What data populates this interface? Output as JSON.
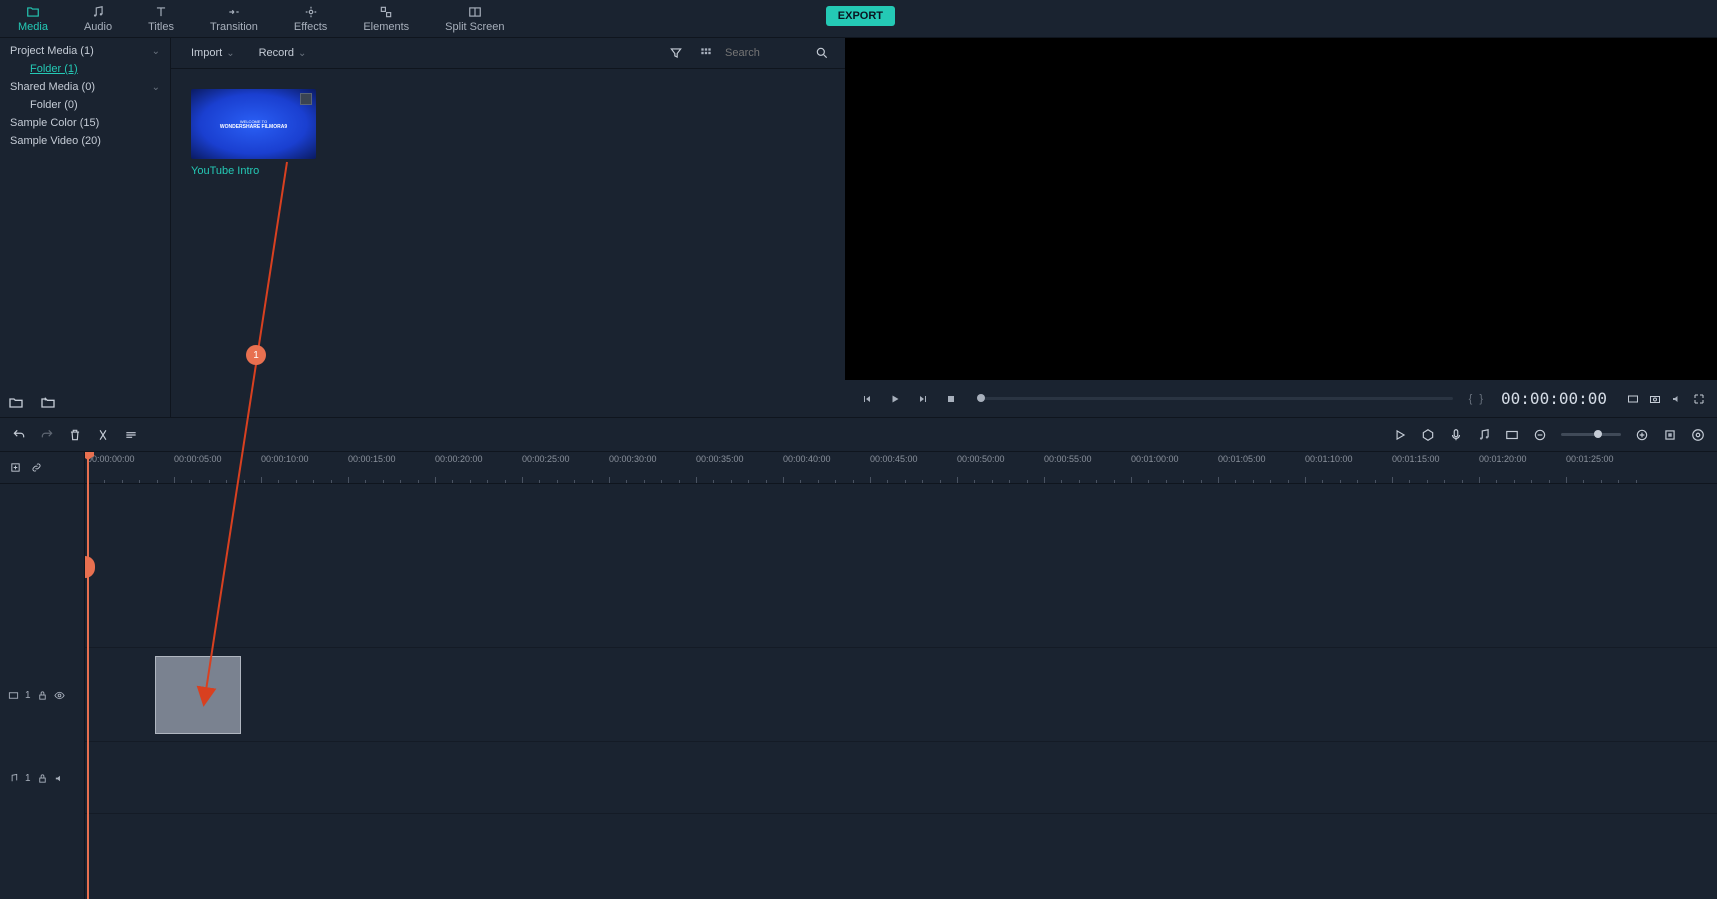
{
  "tabs": {
    "media": "Media",
    "audio": "Audio",
    "titles": "Titles",
    "transition": "Transition",
    "effects": "Effects",
    "elements": "Elements",
    "split_screen": "Split Screen"
  },
  "export_label": "EXPORT",
  "sidebar": {
    "project_media": "Project Media (1)",
    "folder_1": "Folder (1)",
    "shared_media": "Shared Media (0)",
    "folder_0": "Folder (0)",
    "sample_color": "Sample Color (15)",
    "sample_video": "Sample Video (20)"
  },
  "media_toolbar": {
    "import": "Import",
    "record": "Record",
    "search_placeholder": "Search"
  },
  "media_item": {
    "thumb_line1": "WELCOME TO",
    "thumb_line2": "WONDERSHARE FILMORA9",
    "label": "YouTube Intro"
  },
  "preview": {
    "timecode": "00:00:00:00",
    "brackets": "{  }"
  },
  "ruler_marks": [
    "00:00:00:00",
    "00:00:05:00",
    "00:00:10:00",
    "00:00:15:00",
    "00:00:20:00",
    "00:00:25:00",
    "00:00:30:00",
    "00:00:35:00",
    "00:00:40:00",
    "00:00:45:00",
    "00:00:50:00",
    "00:00:55:00",
    "00:01:00:00",
    "00:01:05:00",
    "00:01:10:00",
    "00:01:15:00",
    "00:01:20:00",
    "00:01:25:00"
  ],
  "track_labels": {
    "video1": "1",
    "audio1": "1"
  },
  "annotation": {
    "step": "1"
  }
}
